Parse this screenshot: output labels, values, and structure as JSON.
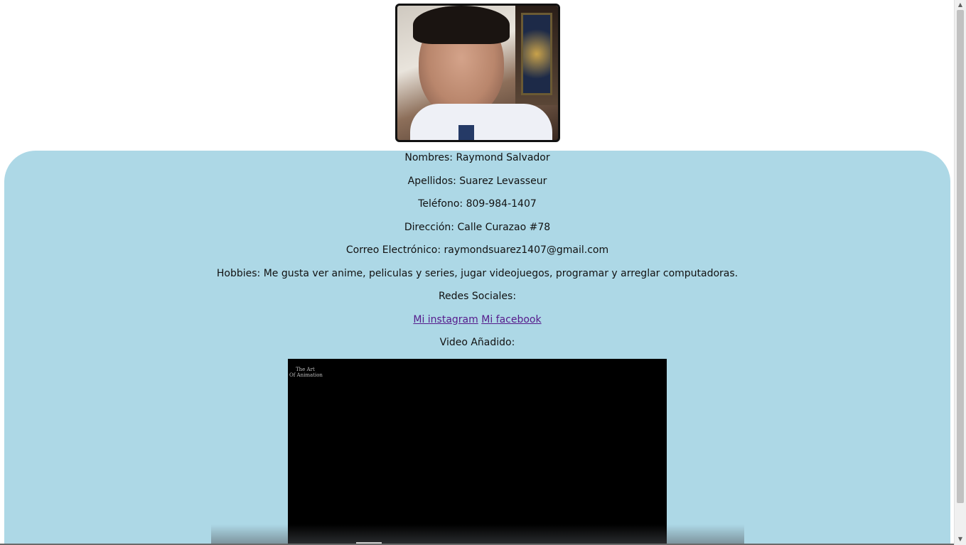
{
  "profile": {
    "photo_alt": "Foto de perfil"
  },
  "info": {
    "nombres": "Nombres: Raymond Salvador",
    "apellidos": "Apellidos: Suarez Levasseur",
    "telefono": "Teléfono: 809-984-1407",
    "direccion": "Dirección: Calle Curazao #78",
    "correo": "Correo Electrónico: raymondsuarez1407@gmail.com",
    "hobbies": "Hobbies: Me gusta ver anime, peliculas y series, jugar videojuegos, programar y arreglar computadoras.",
    "redes_label": "Redes Sociales:",
    "instagram_link": "Mi instagram",
    "facebook_link": "Mi facebook",
    "video_label": "Video Añadido:"
  },
  "video": {
    "logo_line1": "The Art",
    "logo_line2": "Of Animation"
  },
  "colors": {
    "panel": "#add8e6",
    "link": "#551a8b",
    "video_bg": "#000000"
  },
  "icons": {
    "scroll_up": "▲",
    "scroll_down": "▼"
  }
}
